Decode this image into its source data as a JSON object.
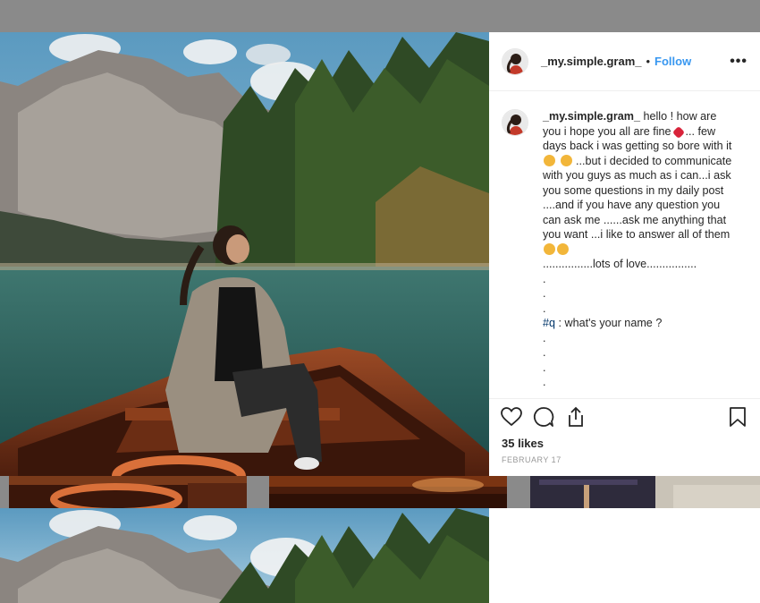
{
  "post": {
    "username": "_my.simple.gram_",
    "dot": "•",
    "follow_label": "Follow",
    "more_label": "•••",
    "caption": {
      "username": "_my.simple.gram_",
      "line1": "hello ! how are you i hope you all are fine",
      "line1b": "... few days back i was getting so bore with it",
      "line2": "...but i decided to communicate with you guys as much as i can...i ask you some questions in my daily post ....and if you have any question you can ask me ......ask me anything that you want ...i like to answer all of them",
      "love": "................lots of love................",
      "dots1": [
        ".",
        ".",
        "."
      ],
      "hashtag": "#q",
      "question": " : what's your name ?",
      "dots2": [
        ".",
        ".",
        ".",
        "."
      ]
    },
    "likes": "35 likes",
    "date": "FEBRUARY 17",
    "icons": {
      "like": "heart-icon",
      "comment": "comment-icon",
      "share": "share-icon",
      "save": "bookmark-icon"
    }
  },
  "colors": {
    "link": "#3897f0",
    "text": "#262626",
    "muted": "#999999",
    "backdrop": "#8a8a8a"
  }
}
